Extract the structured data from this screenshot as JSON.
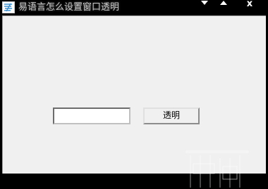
{
  "window": {
    "title": "易语言怎么设置窗口透明",
    "controls": {
      "minimize_icon": "triangle-down-icon",
      "maximize_icon": "triangle-up-icon",
      "close_label": "x"
    }
  },
  "form": {
    "textbox_value": "",
    "button_label": "透明"
  },
  "colors": {
    "titlebar": "#000000",
    "client": "#f0f0f0",
    "icon_accent": "#3a8fd0"
  }
}
